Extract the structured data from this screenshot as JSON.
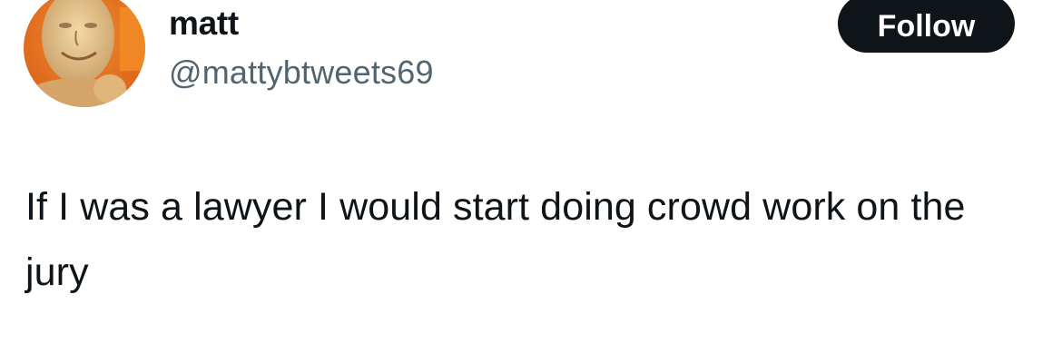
{
  "author": {
    "display_name": "matt",
    "handle": "@mattybtweets69",
    "avatar_icon": "profile-photo-avatar"
  },
  "actions": {
    "follow_label": "Follow"
  },
  "tweet": {
    "text": "If I was a lawyer I would start doing crowd work on the jury"
  },
  "colors": {
    "text_primary": "#0f1419",
    "text_secondary": "#536471",
    "button_bg": "#0f1419",
    "button_text": "#ffffff",
    "background": "#ffffff"
  }
}
